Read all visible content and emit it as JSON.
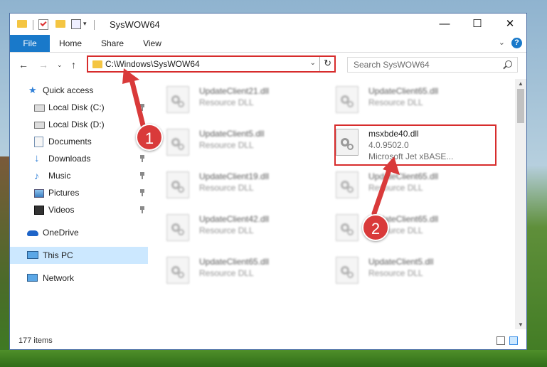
{
  "window": {
    "title": "SysWOW64",
    "controls": {
      "minimize": "—",
      "maximize": "☐",
      "close": "✕"
    }
  },
  "ribbon": {
    "tabs": [
      {
        "label": "File",
        "active": true
      },
      {
        "label": "Home"
      },
      {
        "label": "Share"
      },
      {
        "label": "View"
      }
    ],
    "help": "?"
  },
  "nav": {
    "address": "C:\\Windows\\SysWOW64",
    "search_placeholder": "Search SysWOW64"
  },
  "sidebar": {
    "items": [
      {
        "label": "Quick access",
        "icon": "star-icon"
      },
      {
        "label": "Local Disk (C:)",
        "icon": "drive-icon",
        "pinned": true
      },
      {
        "label": "Local Disk (D:)",
        "icon": "drive-icon",
        "pinned": true
      },
      {
        "label": "Documents",
        "icon": "documents-icon",
        "pinned": true
      },
      {
        "label": "Downloads",
        "icon": "download-icon",
        "pinned": true
      },
      {
        "label": "Music",
        "icon": "music-icon",
        "pinned": true
      },
      {
        "label": "Pictures",
        "icon": "pictures-icon",
        "pinned": true
      },
      {
        "label": "Videos",
        "icon": "videos-icon",
        "pinned": true
      },
      {
        "label": "OneDrive",
        "icon": "cloud-icon"
      },
      {
        "label": "This PC",
        "icon": "computer-icon",
        "selected": true
      },
      {
        "label": "Network",
        "icon": "network-icon"
      }
    ]
  },
  "files": {
    "left": [
      {
        "name": "UpdateClient21.dll",
        "type": "Resource DLL"
      },
      {
        "name": "UpdateClient5.dll",
        "type": "Resource DLL"
      },
      {
        "name": "UpdateClient19.dll",
        "type": "Resource DLL"
      },
      {
        "name": "UpdateClient42.dll",
        "type": "Resource DLL"
      },
      {
        "name": "UpdateClient65.dll",
        "type": "Resource DLL"
      }
    ],
    "right": [
      {
        "name": "UpdateClient65.dll",
        "type": "Resource DLL"
      },
      {
        "name": "msxbde40.dll",
        "version": "4.0.9502.0",
        "description": "Microsoft Jet xBASE...",
        "highlighted": true
      },
      {
        "name": "UpdateClient65.dll",
        "type": "Resource DLL"
      },
      {
        "name": "UpdateClient65.dll",
        "type": "Resource DLL"
      },
      {
        "name": "UpdateClient5.dll",
        "type": "Resource DLL"
      }
    ]
  },
  "status": {
    "item_count": "177 items"
  },
  "annotations": {
    "step1": "1",
    "step2": "2"
  },
  "colors": {
    "accent": "#1979ca",
    "highlight": "#d72c2c",
    "selection": "#cce8ff"
  }
}
